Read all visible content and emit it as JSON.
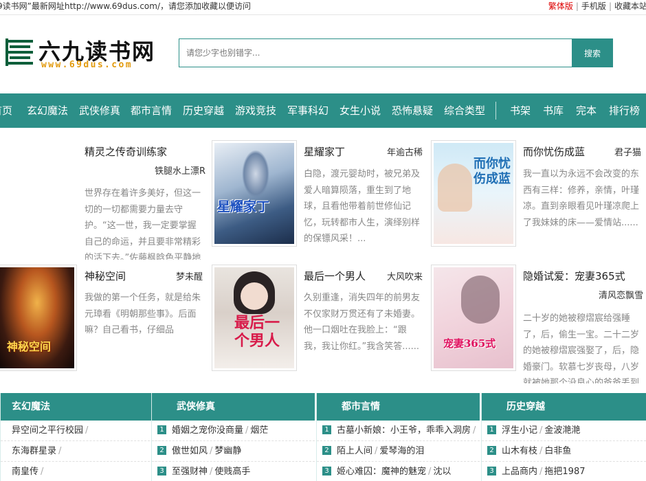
{
  "topbar": {
    "notice": "9读书网”最新网址http://www.69dus.com/，请您添加收藏以便访问",
    "links": [
      "繁体版",
      "手机版",
      "收藏本站"
    ]
  },
  "logo": {
    "cn": "六九读书网",
    "url": "www.69dus.com"
  },
  "search": {
    "placeholder": "请您少字也别错字...",
    "button": "搜索"
  },
  "nav": {
    "items": [
      "首页",
      "玄幻魔法",
      "武侠修真",
      "都市言情",
      "历史穿越",
      "游戏竞技",
      "军事科幻",
      "女生小说",
      "恐怖悬疑",
      "综合类型",
      "书架",
      "书库",
      "完本",
      "排行榜"
    ]
  },
  "books": [
    {
      "title": "精灵之传奇训练家",
      "author": "铁腿水上漂R",
      "desc": "世界存在着许多美好，但这一切的一切都需要力量去守护。“这一世，我一定要掌握自己的命运，并且要非常精彩的活下去。”佐藤枫晗色平静地想道精"
    },
    {
      "title": "星耀家丁",
      "author": "年逾古稀",
      "desc": "白隐，渡元婴劫时，被兄弟及爱人暗算陨落，重生到了地球，且看他带着前世修仙记忆，玩转都市人生，演绎别样的保镖风采！...",
      "cover_text": "星耀家丁"
    },
    {
      "title": "而你忧伤成蓝",
      "author": "君子猫",
      "desc": "我一直以为永远不会改变的东西有三样：修养，亲情，叶瑾凉。直到亲眼看见叶瑾凉爬上了我妹妹的床——爱情站......",
      "cover_text": "而你忧伤成蓝"
    },
    {
      "title": "神秘空间",
      "author": "梦未醒",
      "desc": "我做的第一个任务，就是给朱元璋看《明朝那些事》。后面嘛？自己看书，仔细品味。.....",
      "cover_text": "神秘空间"
    },
    {
      "title": "最后一个男人",
      "author": "大风吹来",
      "desc": "久别重逢，消失四年的前男友不仅家财万贯还有了未婚妻。他一口烟吐在我脸上：“跟我，我让你红。”我含笑答......",
      "cover_text": "最后一个男人"
    },
    {
      "title": "隐婚试爱：宠妻365式",
      "author": "清风恋飘雪",
      "desc": "二十岁的她被穆熠宸给强睡了，后，偷生一宝。二十二岁的她被穆熠宸强娶了，后，隐婚豪门。软慕七岁丧母，八岁就被她那个没良心的爸爸丢到国外去了。",
      "cover_text": "宠妻365式"
    }
  ],
  "categories": [
    {
      "name": "玄幻魔法",
      "rows": [
        [
          "异空间之平行校园",
          ""
        ],
        [
          "东海群星录",
          ""
        ],
        [
          "南皇传",
          ""
        ]
      ]
    },
    {
      "name": "武侠修真",
      "rows": [
        [
          "婚姻之宠你没商量",
          "烟茫"
        ],
        [
          "傲世如风",
          "梦幽静"
        ],
        [
          "至强财神",
          "使贱高手"
        ]
      ]
    },
    {
      "name": "都市言情",
      "rows": [
        [
          "古墓小新娘：小王爷，乖乖入洞房",
          ""
        ],
        [
          "陌上人间",
          "爱琴海的泪"
        ],
        [
          "姬心难囚：魔神的魅宠",
          "沈以"
        ]
      ]
    },
    {
      "name": "历史穿越",
      "rows": [
        [
          "浮生小记",
          "金波滟滟"
        ],
        [
          "山木有枝",
          "白非鱼"
        ],
        [
          "上品商内",
          "拖把1987"
        ]
      ]
    }
  ],
  "rank_numbers": [
    "1",
    "2",
    "3"
  ],
  "colors": {
    "accent": "#2c8f88",
    "logo_url": "#e29a0c",
    "red_link": "#dd0000"
  }
}
